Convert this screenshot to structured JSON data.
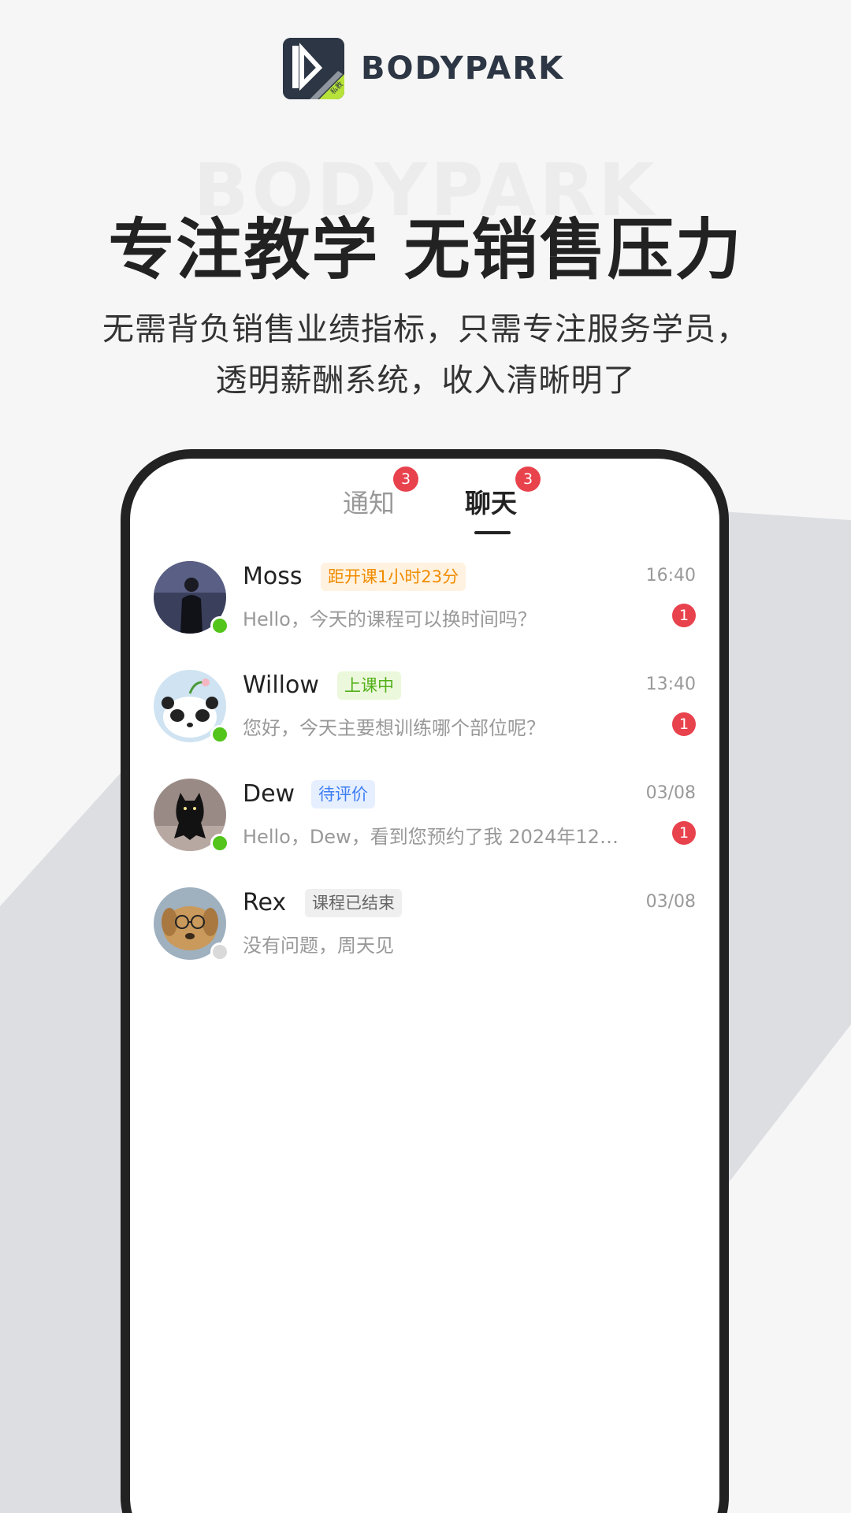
{
  "brand": {
    "name": "BODYPARK",
    "badge": "私教",
    "watermark": "BODYPARK"
  },
  "hero": {
    "headline": "专注教学 无销售压力",
    "subline_1": "无需背负销售业绩指标，只需专注服务学员，",
    "subline_2": "透明薪酬系统，收入清晰明了"
  },
  "tabs": [
    {
      "label": "通知",
      "badge": "3",
      "active": false
    },
    {
      "label": "聊天",
      "badge": "3",
      "active": true
    }
  ],
  "chats": [
    {
      "name": "Moss",
      "tag": "距开课1小时23分",
      "tag_style": "orange",
      "time": "16:40",
      "preview": "Hello，今天的课程可以换时间吗？",
      "unread": "1",
      "online": true
    },
    {
      "name": "Willow",
      "tag": "上课中",
      "tag_style": "green",
      "time": "13:40",
      "preview": "您好，今天主要想训练哪个部位呢？",
      "unread": "1",
      "online": true
    },
    {
      "name": "Dew",
      "tag": "待评价",
      "tag_style": "blue",
      "time": "03/08",
      "preview": "Hello，Dew，看到您预约了我 2024年12…",
      "unread": "1",
      "online": true
    },
    {
      "name": "Rex",
      "tag": "课程已结束",
      "tag_style": "gray",
      "time": "03/08",
      "preview": "没有问题，周天见",
      "unread": null,
      "online": false
    }
  ],
  "colors": {
    "brand_dark": "#2c3644",
    "brand_accent": "#b6e23a",
    "badge_red": "#e8424d",
    "online_green": "#52c41a",
    "offline_gray": "#d9d9d9",
    "tag_orange_bg": "#fff2e0",
    "tag_orange_fg": "#f08c00",
    "tag_green_bg": "#ecf8dc",
    "tag_green_fg": "#52b11a",
    "tag_blue_bg": "#e6efff",
    "tag_blue_fg": "#3d7ef5",
    "tag_gray_bg": "#efefef",
    "tag_gray_fg": "#666666"
  },
  "icons": {
    "logo": "bodypark-logo-icon"
  }
}
